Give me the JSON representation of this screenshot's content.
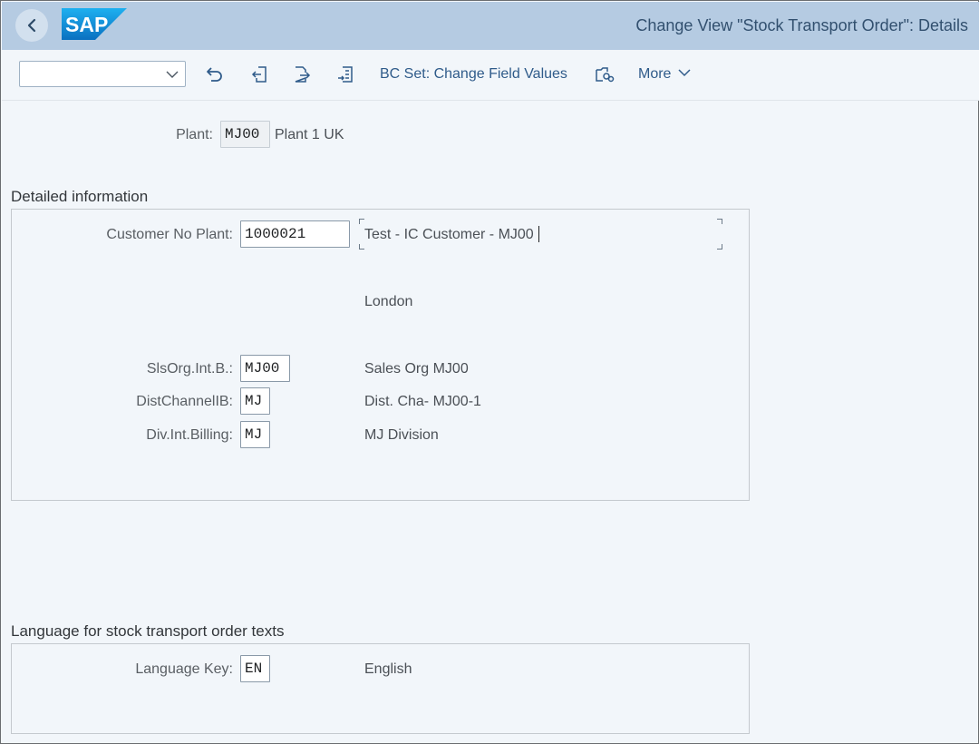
{
  "header": {
    "title": "Change View \"Stock Transport Order\": Details",
    "logo_text": "SAP",
    "back_icon": "chevron-left-icon"
  },
  "toolbar": {
    "command_field_value": "",
    "bc_set_label": "BC Set: Change Field Values",
    "more_label": "More",
    "icons": [
      "undo-icon",
      "previous-entry-icon",
      "next-entry-icon",
      "transport-icon",
      "variable-list-icon"
    ]
  },
  "plant": {
    "label": "Plant:",
    "code": "MJ00",
    "name": "Plant 1 UK"
  },
  "detailed": {
    "title": "Detailed information",
    "customer_label": "Customer No Plant:",
    "customer_value": "1000021",
    "customer_name": "Test - IC Customer - MJ00",
    "city": "London",
    "sales_org_label": "SlsOrg.Int.B.:",
    "sales_org_value": "MJ00",
    "sales_org_desc": "Sales Org MJ00",
    "dist_channel_label": "DistChannelIB:",
    "dist_channel_value": "MJ",
    "dist_channel_desc": "Dist. Cha- MJ00-1",
    "division_label": "Div.Int.Billing:",
    "division_value": "MJ",
    "division_desc": "MJ Division"
  },
  "language": {
    "title": "Language for stock transport order texts",
    "label": "Language Key:",
    "value": "EN",
    "desc": "English"
  },
  "colors": {
    "header_bg": "#b5cbe2",
    "page_bg": "#f2f6fa",
    "link_blue": "#2f5b8a",
    "sap_blue": "#1a9ee0"
  }
}
